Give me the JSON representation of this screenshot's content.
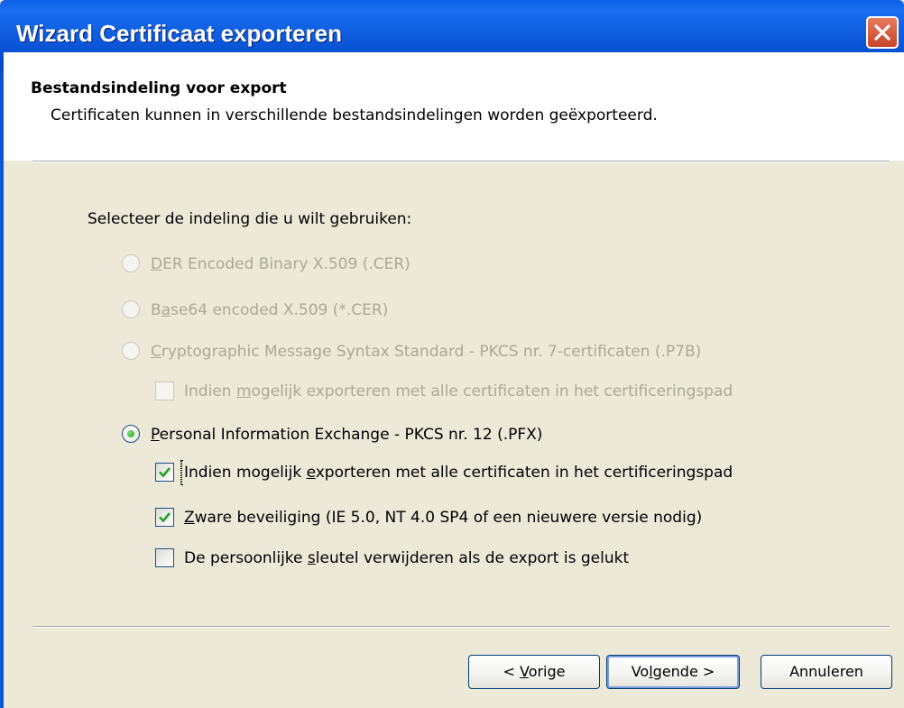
{
  "window": {
    "title": "Wizard Certificaat exporteren",
    "title_bar_color": "#0b56d9",
    "close_icon": "close-icon"
  },
  "header": {
    "title": "Bestandsindeling voor export",
    "subtitle": "Certificaten kunnen in verschillende bestandsindelingen worden geëxporteerd."
  },
  "prompt": "Selecteer de indeling die u wilt gebruiken:",
  "options": {
    "der": {
      "label_ul": "D",
      "label_rest": "ER Encoded Binary X.509 (.CER)",
      "enabled": false,
      "selected": false
    },
    "base64": {
      "label_pre": "B",
      "label_ul": "a",
      "label_rest": "se64 encoded X.509 (*.CER)",
      "enabled": false,
      "selected": false
    },
    "pkcs7": {
      "label_ul": "C",
      "label_rest": "ryptographic Message Syntax Standard - PKCS nr. 7-certificaten (.P7B)",
      "enabled": false,
      "selected": false
    },
    "pkcs7_include": {
      "label_pre": "Indien ",
      "label_ul": "m",
      "label_rest": "ogelijk exporteren met alle certificaten in het certificeringspad",
      "enabled": false,
      "checked": false
    },
    "pfx": {
      "label_ul": "P",
      "label_rest": "ersonal Information Exchange - PKCS nr. 12 (.PFX)",
      "enabled": true,
      "selected": true
    },
    "pfx_include": {
      "label_pre": "Indien mogelijk ",
      "label_ul": "e",
      "label_rest": "xporteren met alle certificaten in het certificeringspad",
      "enabled": true,
      "checked": true
    },
    "strong": {
      "label_ul": "Z",
      "label_rest": "ware beveiliging (IE 5.0, NT 4.0 SP4 of een nieuwere versie nodig)",
      "enabled": true,
      "checked": true
    },
    "delete_key": {
      "label_pre": "De persoonlijke ",
      "label_ul": "s",
      "label_rest": "leutel verwijderen als de export is gelukt",
      "enabled": true,
      "checked": false
    }
  },
  "buttons": {
    "back": {
      "pre": "< ",
      "ul": "V",
      "rest": "orige"
    },
    "next": {
      "pre": "Vo",
      "ul": "l",
      "rest": "gende >"
    },
    "cancel": {
      "label": "Annuleren"
    }
  },
  "colors": {
    "dialog_bg": "#ece9d8",
    "disabled_text": "#aca899",
    "check_green": "#21a121"
  }
}
